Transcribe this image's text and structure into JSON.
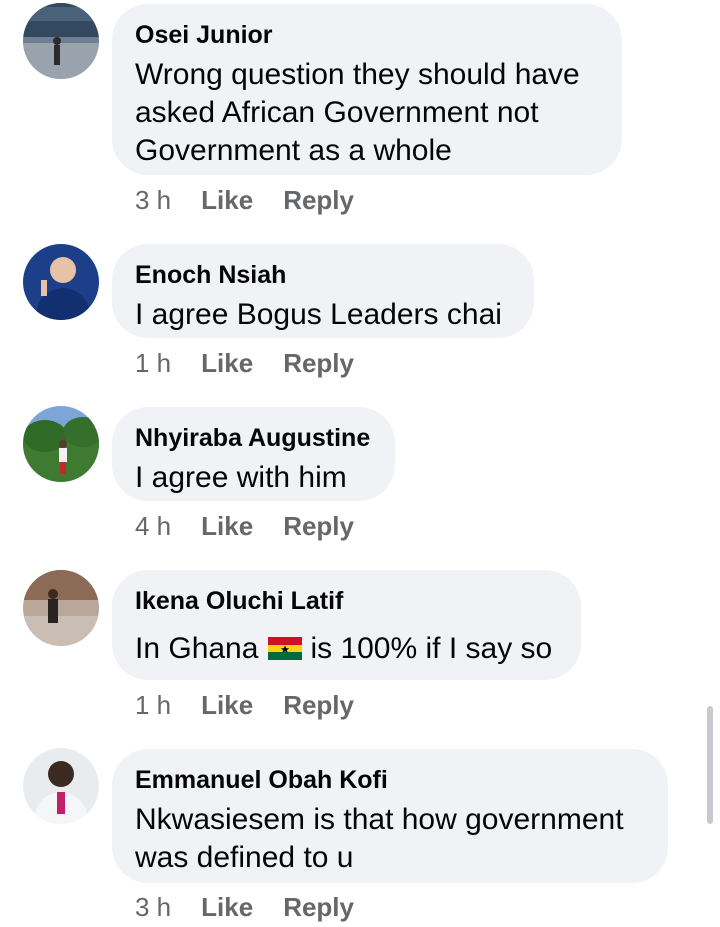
{
  "comments": [
    {
      "author": "Osei Junior",
      "text_lines": [
        "Wrong question they should have",
        "asked African Government not",
        "Government as a whole"
      ],
      "time": "3 h",
      "like": "Like",
      "reply": "Reply",
      "avatar": "person-icon"
    },
    {
      "author": "Enoch Nsiah",
      "text_lines": [
        "I agree Bogus Leaders chai"
      ],
      "time": "1 h",
      "like": "Like",
      "reply": "Reply",
      "avatar": "person-icon"
    },
    {
      "author": "Nhyiraba Augustine",
      "text_lines": [
        "I agree with him"
      ],
      "time": "4 h",
      "like": "Like",
      "reply": "Reply",
      "avatar": "person-icon"
    },
    {
      "author": "Ikena Oluchi Latif",
      "text_before_flag": "In Ghana",
      "flag": "ghana-flag-emoji",
      "text_after_flag": "is 100% if I say so",
      "time": "1 h",
      "like": "Like",
      "reply": "Reply",
      "avatar": "person-icon"
    },
    {
      "author": "Emmanuel Obah Kofi",
      "text_lines": [
        "Nkwasiesem is that how government",
        "was defined to u"
      ],
      "time": "3 h",
      "like": "Like",
      "reply": "Reply",
      "avatar": "person-icon"
    }
  ],
  "colors": {
    "bubble": "#f0f2f5",
    "meta_text": "#65676b",
    "text": "#050505"
  }
}
